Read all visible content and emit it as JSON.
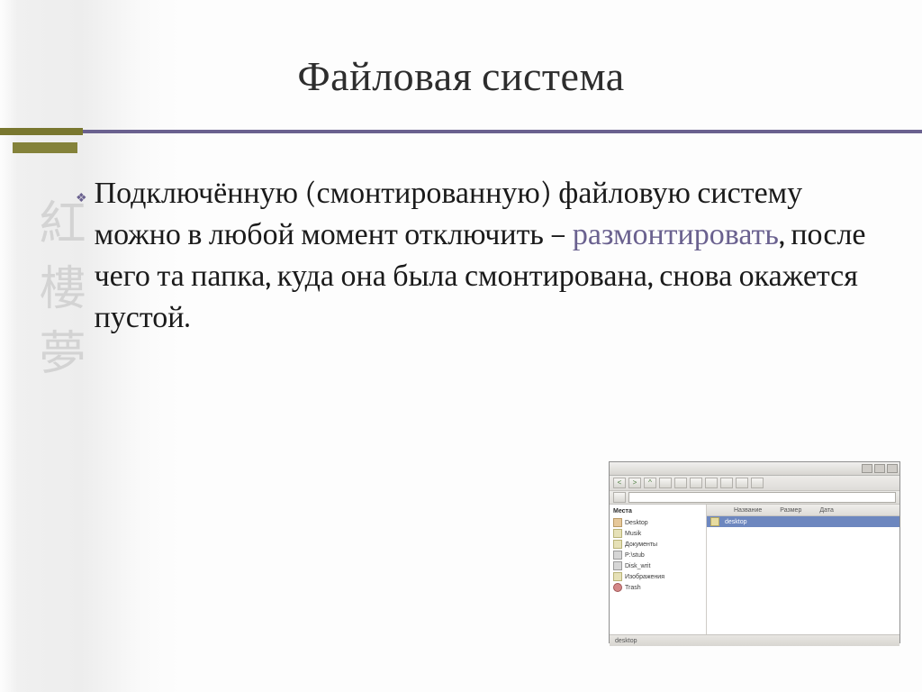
{
  "title": "Файловая система",
  "bullet_glyph": "❖",
  "body": {
    "pre": "Подключённую (смонтированную) файловую систему можно в любой момент отключить – ",
    "hl": "размонтировать",
    "post": ", после чего та папка, куда она была смонтирована, снова окажется пустой."
  },
  "spine": "紅樓夢",
  "thumb": {
    "sidebar_header": "Места",
    "items": [
      "Desktop",
      "Musik",
      "Документы",
      "P:\\stub",
      "Disk_writ",
      "Изображения",
      "Trash"
    ],
    "cols": [
      "Название",
      "Размер",
      "Дата"
    ],
    "selected": "desktop",
    "status": "desktop"
  }
}
